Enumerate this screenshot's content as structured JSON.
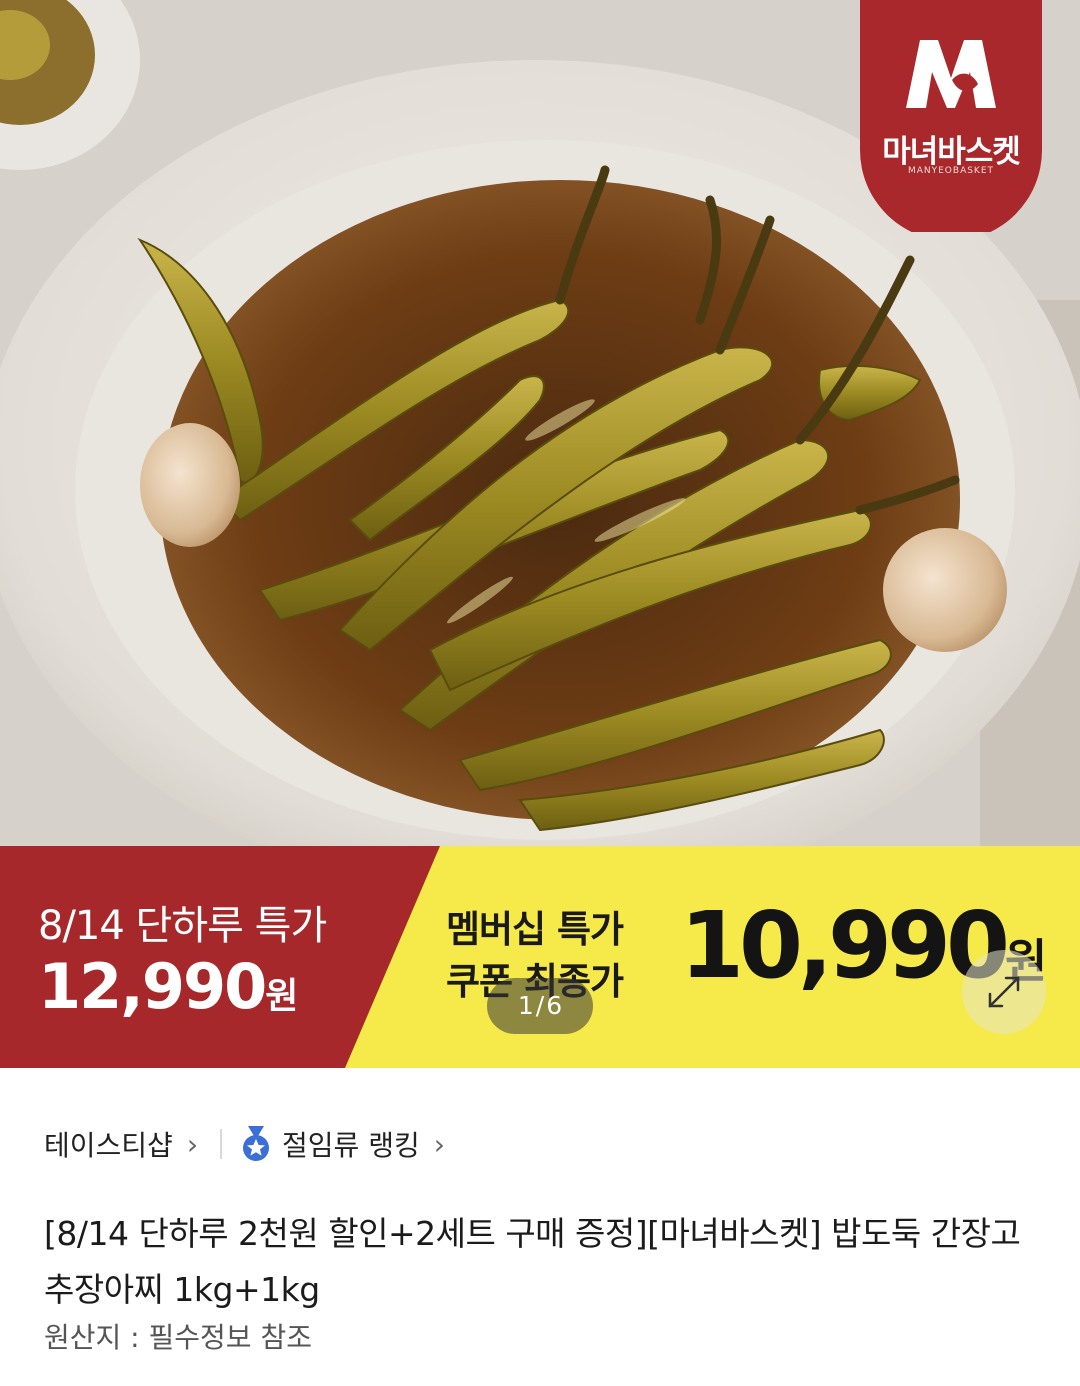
{
  "brand": {
    "name": "마녀바스켓",
    "sub": "MANYEOBASKET"
  },
  "banner": {
    "deal_title": "8/14 단하루 특가",
    "deal_price": "12,990",
    "deal_currency": "원",
    "member_line1": "멤버십 특가",
    "member_line2": "쿠폰 최종가",
    "member_price": "10,990",
    "member_currency": "원"
  },
  "gallery": {
    "current": "1",
    "separator": "/",
    "total": "6"
  },
  "store": {
    "name": "테이스티샵",
    "ranking": "절임류 랭킹"
  },
  "product": {
    "title": "[8/14 단하루 2천원 할인+2세트 구매 증정][마녀바스켓] 밥도둑 간장고추장아찌 1kg+1kg",
    "origin": "원산지 : 필수정보 참조"
  },
  "colors": {
    "banner_red": "#a6282a",
    "banner_yellow": "#f6e94a",
    "brand_red": "#a9282c"
  },
  "icons": {
    "chevron": "chevron-right-icon",
    "medal": "medal-icon",
    "expand": "expand-icon"
  }
}
